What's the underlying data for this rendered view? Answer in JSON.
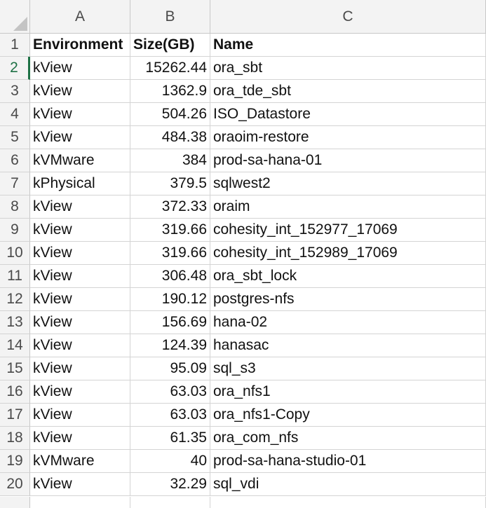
{
  "columns": [
    "A",
    "B",
    "C"
  ],
  "header": {
    "row_number": "1",
    "environment": "Environment",
    "size": "Size(GB)",
    "name": "Name"
  },
  "rows": [
    {
      "n": "2",
      "env": "kView",
      "size": "15262.44",
      "name": "ora_sbt"
    },
    {
      "n": "3",
      "env": "kView",
      "size": "1362.9",
      "name": "ora_tde_sbt"
    },
    {
      "n": "4",
      "env": "kView",
      "size": "504.26",
      "name": "ISO_Datastore"
    },
    {
      "n": "5",
      "env": "kView",
      "size": "484.38",
      "name": "oraoim-restore"
    },
    {
      "n": "6",
      "env": "kVMware",
      "size": "384",
      "name": "prod-sa-hana-01"
    },
    {
      "n": "7",
      "env": "kPhysical",
      "size": "379.5",
      "name": "sqlwest2"
    },
    {
      "n": "8",
      "env": "kView",
      "size": "372.33",
      "name": "oraim"
    },
    {
      "n": "9",
      "env": "kView",
      "size": "319.66",
      "name": "cohesity_int_152977_17069"
    },
    {
      "n": "10",
      "env": "kView",
      "size": "319.66",
      "name": "cohesity_int_152989_17069"
    },
    {
      "n": "11",
      "env": "kView",
      "size": "306.48",
      "name": "ora_sbt_lock"
    },
    {
      "n": "12",
      "env": "kView",
      "size": "190.12",
      "name": "postgres-nfs"
    },
    {
      "n": "13",
      "env": "kView",
      "size": "156.69",
      "name": "hana-02"
    },
    {
      "n": "14",
      "env": "kView",
      "size": "124.39",
      "name": "hanasac"
    },
    {
      "n": "15",
      "env": "kView",
      "size": "95.09",
      "name": "sql_s3"
    },
    {
      "n": "16",
      "env": "kView",
      "size": "63.03",
      "name": "ora_nfs1"
    },
    {
      "n": "17",
      "env": "kView",
      "size": "63.03",
      "name": "ora_nfs1-Copy"
    },
    {
      "n": "18",
      "env": "kView",
      "size": "61.35",
      "name": "ora_com_nfs"
    },
    {
      "n": "19",
      "env": "kVMware",
      "size": "40",
      "name": "prod-sa-hana-studio-01"
    },
    {
      "n": "20",
      "env": "kView",
      "size": "32.29",
      "name": "sql_vdi"
    }
  ],
  "active_row": "2"
}
